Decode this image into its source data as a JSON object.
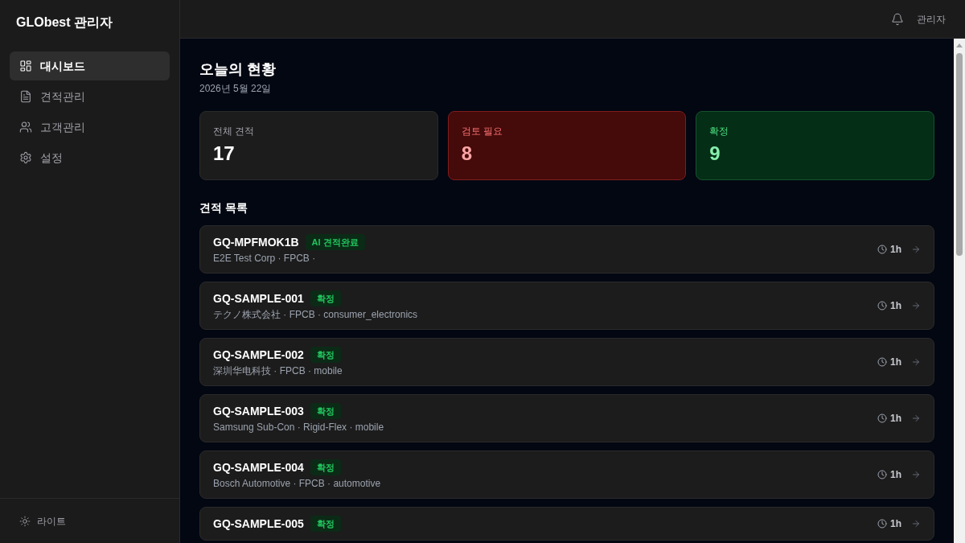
{
  "sidebar": {
    "title": "GLObest 관리자",
    "items": [
      {
        "label": "대시보드",
        "selected": true
      },
      {
        "label": "견적관리",
        "selected": false
      },
      {
        "label": "고객관리",
        "selected": false
      },
      {
        "label": "설정",
        "selected": false
      }
    ],
    "footer": {
      "label": "라이트"
    }
  },
  "header": {
    "user": "관리자"
  },
  "summary": {
    "title": "오늘의 현황",
    "date": "2026년 5월 22일",
    "cards": [
      {
        "kind": "neutral",
        "label": "전체 견적",
        "value": "17"
      },
      {
        "kind": "alert",
        "label": "검토 필요",
        "value": "8"
      },
      {
        "kind": "success",
        "label": "확정",
        "value": "9"
      }
    ]
  },
  "quotes": {
    "title": "견적 목록",
    "items": [
      {
        "id": "GQ-MPFMOK1B",
        "status": "AI 견적완료",
        "details": "E2E Test Corp · FPCB ·",
        "age": "1h"
      },
      {
        "id": "GQ-SAMPLE-001",
        "status": "확정",
        "details": "テクノ株式会社 · FPCB · consumer_electronics",
        "age": "1h"
      },
      {
        "id": "GQ-SAMPLE-002",
        "status": "확정",
        "details": "深圳华电科技 · FPCB · mobile",
        "age": "1h"
      },
      {
        "id": "GQ-SAMPLE-003",
        "status": "확정",
        "details": "Samsung Sub-Con · Rigid-Flex · mobile",
        "age": "1h"
      },
      {
        "id": "GQ-SAMPLE-004",
        "status": "확정",
        "details": "Bosch Automotive · FPCB · automotive",
        "age": "1h"
      },
      {
        "id": "GQ-SAMPLE-005",
        "status": "확정",
        "age": "1h"
      }
    ]
  }
}
